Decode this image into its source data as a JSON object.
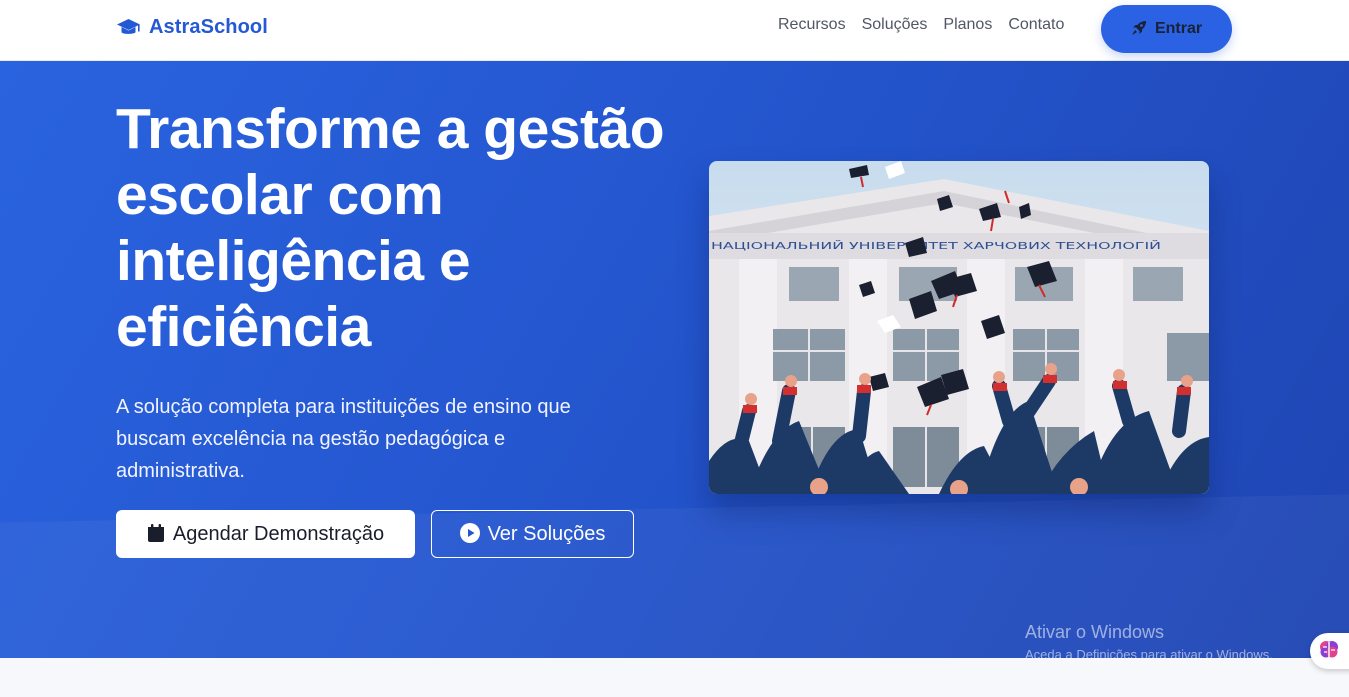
{
  "header": {
    "brand": "AstraSchool",
    "brand_icon": "graduation-cap-icon",
    "nav": [
      "Recursos",
      "Soluções",
      "Planos",
      "Contato"
    ],
    "login_label": "Entrar",
    "login_icon": "rocket-icon"
  },
  "hero": {
    "title": "Transforme a gestão escolar com inteligência e eficiência",
    "subtitle": "A solução completa para instituições de ensino que buscam excelência na gestão pedagógica e administrativa.",
    "primary_button": "Agendar Demonstração",
    "primary_icon": "calendar-icon",
    "secondary_button": "Ver Soluções",
    "secondary_icon": "play-circle-icon",
    "image_building_text": "НАЦІОНАЛЬНИЙ УНІВЕРСИТЕТ ХАРЧОВИХ ТЕХНОЛОГІЙ"
  },
  "watermark": {
    "title": "Ativar o Windows",
    "subtitle": "Aceda a Definições para ativar o Windows."
  },
  "colors": {
    "brand": "#2459d6",
    "hero_start": "#2a63df",
    "hero_end": "#1f45b2",
    "login_button": "#2b61e3"
  }
}
